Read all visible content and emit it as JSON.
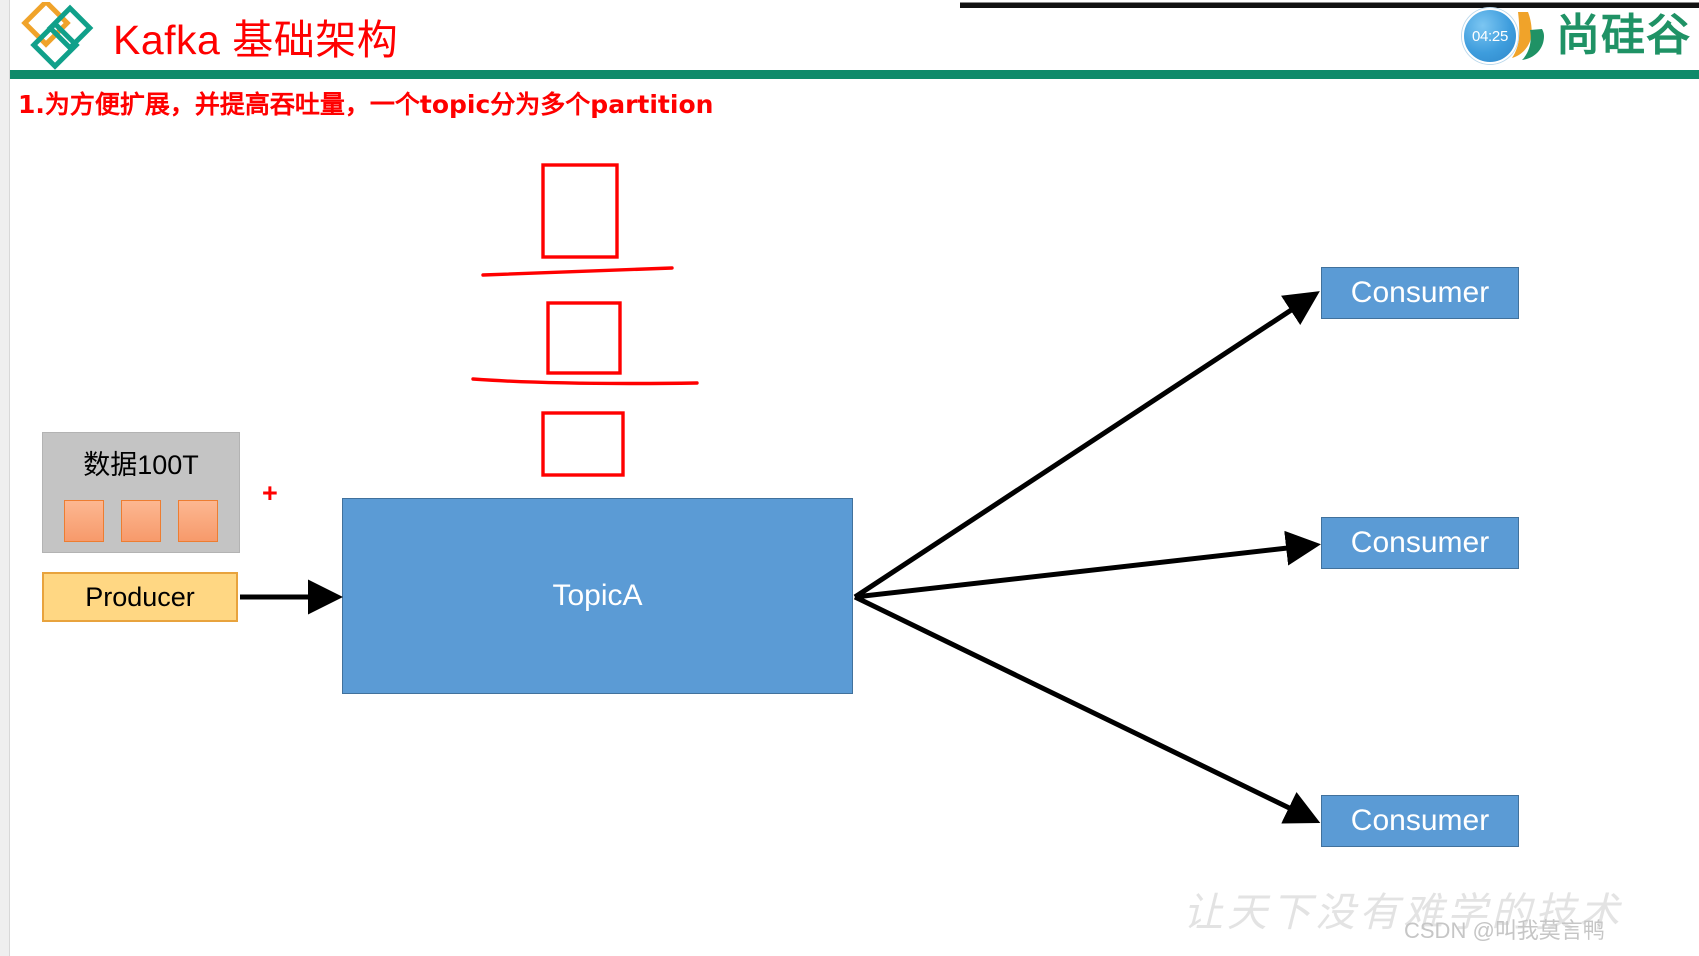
{
  "header": {
    "title": "Kafka 基础架构",
    "logo_icon": "diamonds-logo-icon",
    "brand": {
      "clock_icon": "clock-badge-icon",
      "clock_time": "04:25",
      "swoosh_icon": "atguigu-swoosh-icon",
      "name": "尚硅谷"
    }
  },
  "subtitle": "1.为方便扩展，并提高吞吐量，一个topic分为多个partition",
  "diagram": {
    "data_box": {
      "label": "数据100T",
      "chip_count": 3
    },
    "plus_symbol": "+",
    "producer": {
      "label": "Producer"
    },
    "topic": {
      "label": "TopicA"
    },
    "consumers": [
      {
        "label": "Consumer"
      },
      {
        "label": "Consumer"
      },
      {
        "label": "Consumer"
      }
    ],
    "annotations": {
      "partition_boxes": 3,
      "divider_strokes": 2,
      "ink_color": "#ff0000"
    },
    "arrows": [
      {
        "from": "producer",
        "to": "topic"
      },
      {
        "from": "topic",
        "to": "consumer-1"
      },
      {
        "from": "topic",
        "to": "consumer-2"
      },
      {
        "from": "topic",
        "to": "consumer-3"
      }
    ]
  },
  "watermarks": {
    "brand_slogan": "让天下没有难学的技术",
    "csdn": "CSDN @叫我莫言鸭"
  },
  "colors": {
    "title_red": "#ff0000",
    "rule_green": "#0f8a6a",
    "node_blue": "#5b9bd5",
    "node_blue_border": "#41719c",
    "producer_amber": "#ffd783",
    "producer_border": "#e8a33d",
    "data_gray": "#c4c4c4",
    "chip_orange": "#ed7d31",
    "brand_green": "#1f9265",
    "ink_red": "#ff0000"
  }
}
